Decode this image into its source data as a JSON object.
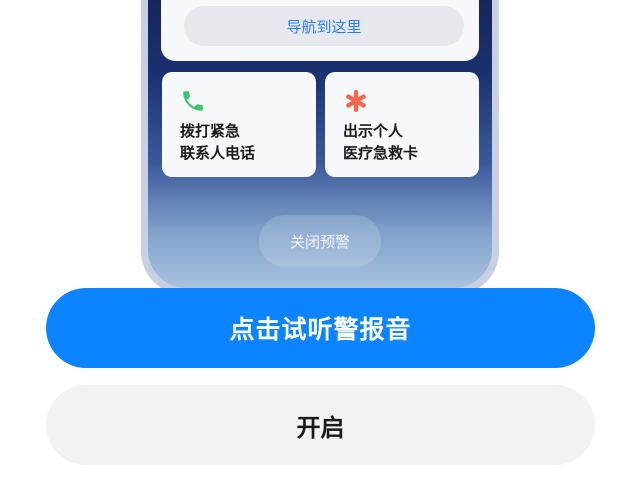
{
  "phone_preview": {
    "nav_button_label": "导航到这里",
    "cards": [
      {
        "icon": "phone-icon",
        "icon_color": "#3cc46f",
        "label_line1": "拨打紧急",
        "label_line2": "联系人电话"
      },
      {
        "icon": "medical-asterisk-icon",
        "icon_color": "#f4684a",
        "label_line1": "出示个人",
        "label_line2": "医疗急救卡"
      }
    ],
    "close_alert_label": "关闭预警"
  },
  "actions": {
    "test_alarm_label": "点击试听警报音",
    "enable_label": "开启"
  },
  "colors": {
    "primary": "#0d84ff",
    "secondary_bg": "#f2f2f2",
    "link": "#2d7ff9"
  }
}
